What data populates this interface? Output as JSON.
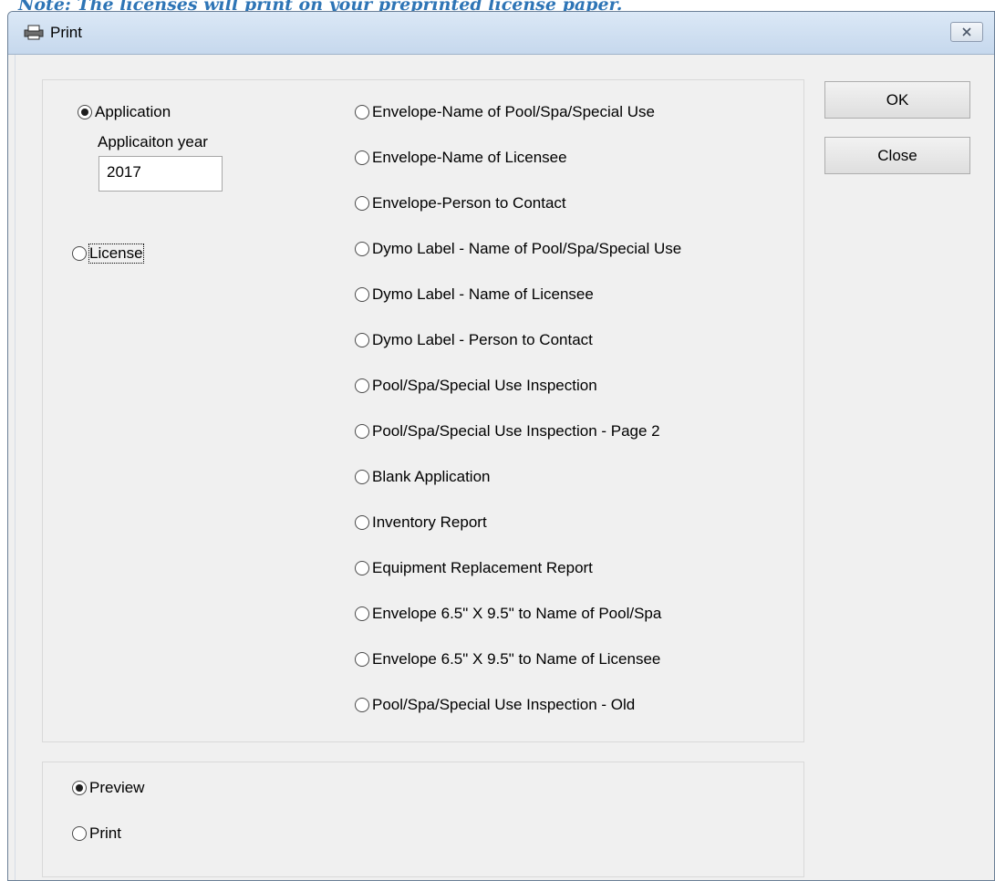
{
  "note": {
    "text": "Note: The licenses will print on your preprinted license paper."
  },
  "window": {
    "title": "Print",
    "close_symbol": "⨯"
  },
  "left_options": {
    "application_label": "Application",
    "application_checked": true,
    "year_label": "Applicaiton year",
    "year_value": "2017",
    "license_label": "License",
    "license_checked": false
  },
  "report_options": [
    "Envelope-Name of Pool/Spa/Special Use",
    "Envelope-Name of Licensee",
    "Envelope-Person to Contact",
    "Dymo Label - Name of Pool/Spa/Special Use",
    "Dymo Label - Name of Licensee",
    "Dymo Label - Person to Contact",
    "Pool/Spa/Special Use Inspection",
    "Pool/Spa/Special Use Inspection - Page 2",
    "Blank Application",
    "Inventory Report",
    "Equipment Replacement Report",
    "Envelope 6.5\" X 9.5\" to Name of Pool/Spa",
    "Envelope 6.5\" X 9.5\" to Name of Licensee",
    "Pool/Spa/Special Use Inspection - Old"
  ],
  "output_options": {
    "preview_label": "Preview",
    "preview_checked": true,
    "print_label": "Print",
    "print_checked": false
  },
  "buttons": {
    "ok": "OK",
    "close": "Close"
  }
}
